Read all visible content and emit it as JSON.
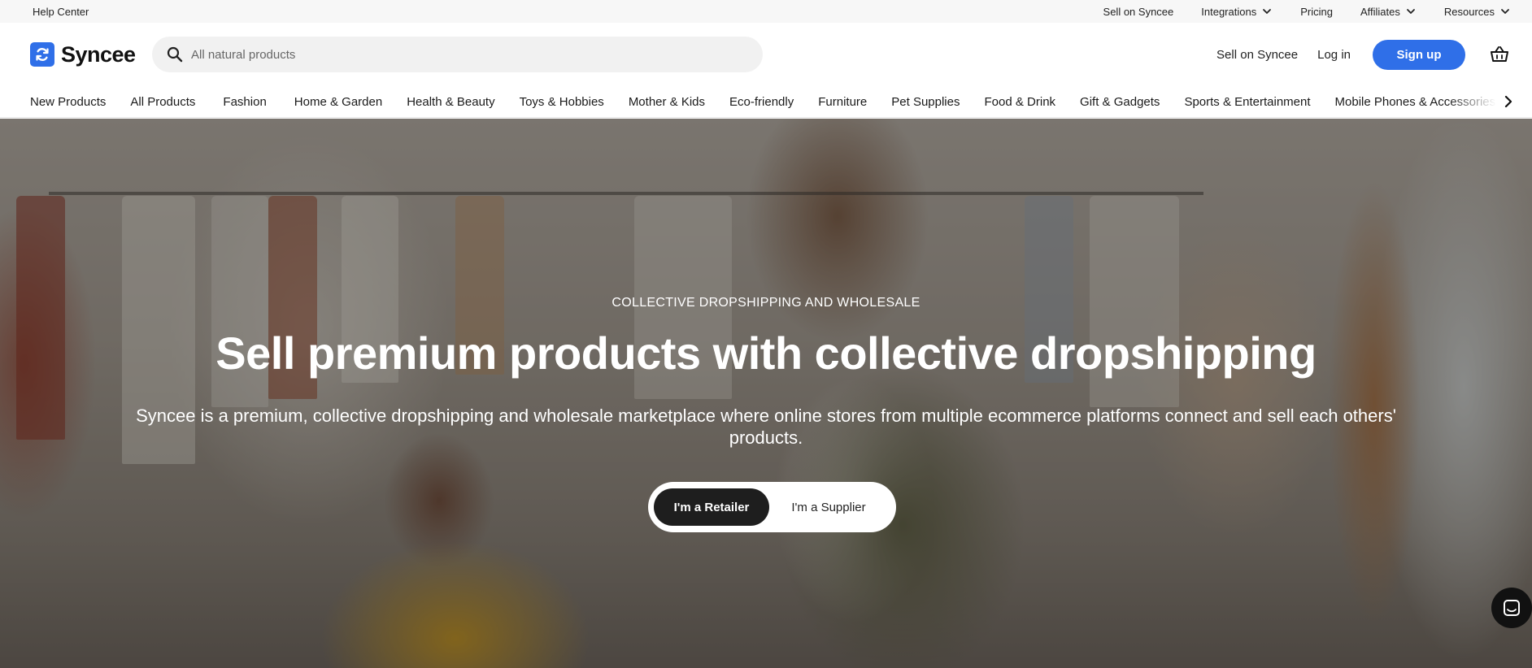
{
  "utility": {
    "help_center": "Help Center",
    "sell_on_syncee": "Sell on Syncee",
    "integrations": "Integrations",
    "pricing": "Pricing",
    "affiliates": "Affiliates",
    "resources": "Resources"
  },
  "header": {
    "logo_text": "Syncee",
    "search_placeholder": "All natural products",
    "sell_link": "Sell on Syncee",
    "login": "Log in",
    "signup": "Sign up"
  },
  "categories": [
    "New Products",
    "All Products",
    "Fashion",
    "Home & Garden",
    "Health & Beauty",
    "Toys & Hobbies",
    "Mother & Kids",
    "Eco-friendly",
    "Furniture",
    "Pet Supplies",
    "Food & Drink",
    "Gift & Gadgets",
    "Sports & Entertainment",
    "Mobile Phones & Accessories"
  ],
  "hero": {
    "eyebrow": "COLLECTIVE DROPSHIPPING AND WHOLESALE",
    "title": "Sell premium products with collective dropshipping",
    "subtitle": "Syncee is a premium, collective dropshipping and wholesale marketplace where online stores from multiple ecommerce platforms connect and sell each others' products.",
    "retailer_button": "I'm a Retailer",
    "supplier_button": "I'm a Supplier"
  },
  "colors": {
    "brand": "#2f6fe8",
    "toggle_active": "#1e1e1e"
  },
  "icons": [
    "logo-icon",
    "search-icon",
    "chevron-down-icon",
    "cart-icon",
    "chevron-right-icon",
    "chat-icon"
  ]
}
